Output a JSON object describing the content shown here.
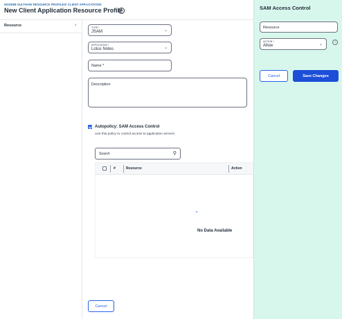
{
  "header": {
    "breadcrumb": "NODE88-SULTHAN/ RESOURCE PROFILES/ CLIENT APPLICATIONS",
    "title": "New Client Application Resource Profile",
    "info_icon": "info-icon"
  },
  "left_nav": {
    "items": [
      {
        "label": "Resource",
        "chevron": "›"
      }
    ]
  },
  "form": {
    "type": {
      "label": "TYPE *",
      "value": "JSAM"
    },
    "application": {
      "label": "APPLICATION *",
      "value": "Lotus Notes"
    },
    "name": {
      "placeholder": "Name *"
    },
    "description": {
      "placeholder": "Description"
    },
    "autopolicy": {
      "checked": true,
      "label": "Autopolicy: SAM Access Control",
      "description": "Use this policy to control access to application servers."
    },
    "search": {
      "placeholder": "Search",
      "icon": "search-icon"
    },
    "table": {
      "columns": [
        "#",
        "Resource",
        "Action"
      ],
      "empty_text": "No Data Available"
    },
    "cancel_label": "Cancel"
  },
  "side_panel": {
    "title": "SAM Access Control",
    "resource": {
      "placeholder": "Resource"
    },
    "action": {
      "label": "ACTION *",
      "value": "Allow"
    },
    "cancel_label": "Cancel",
    "save_label": "Save Changes"
  },
  "colors": {
    "accent": "#2563eb",
    "panel_bg": "#d8f7ec",
    "save_bg": "#1d4ed8"
  }
}
